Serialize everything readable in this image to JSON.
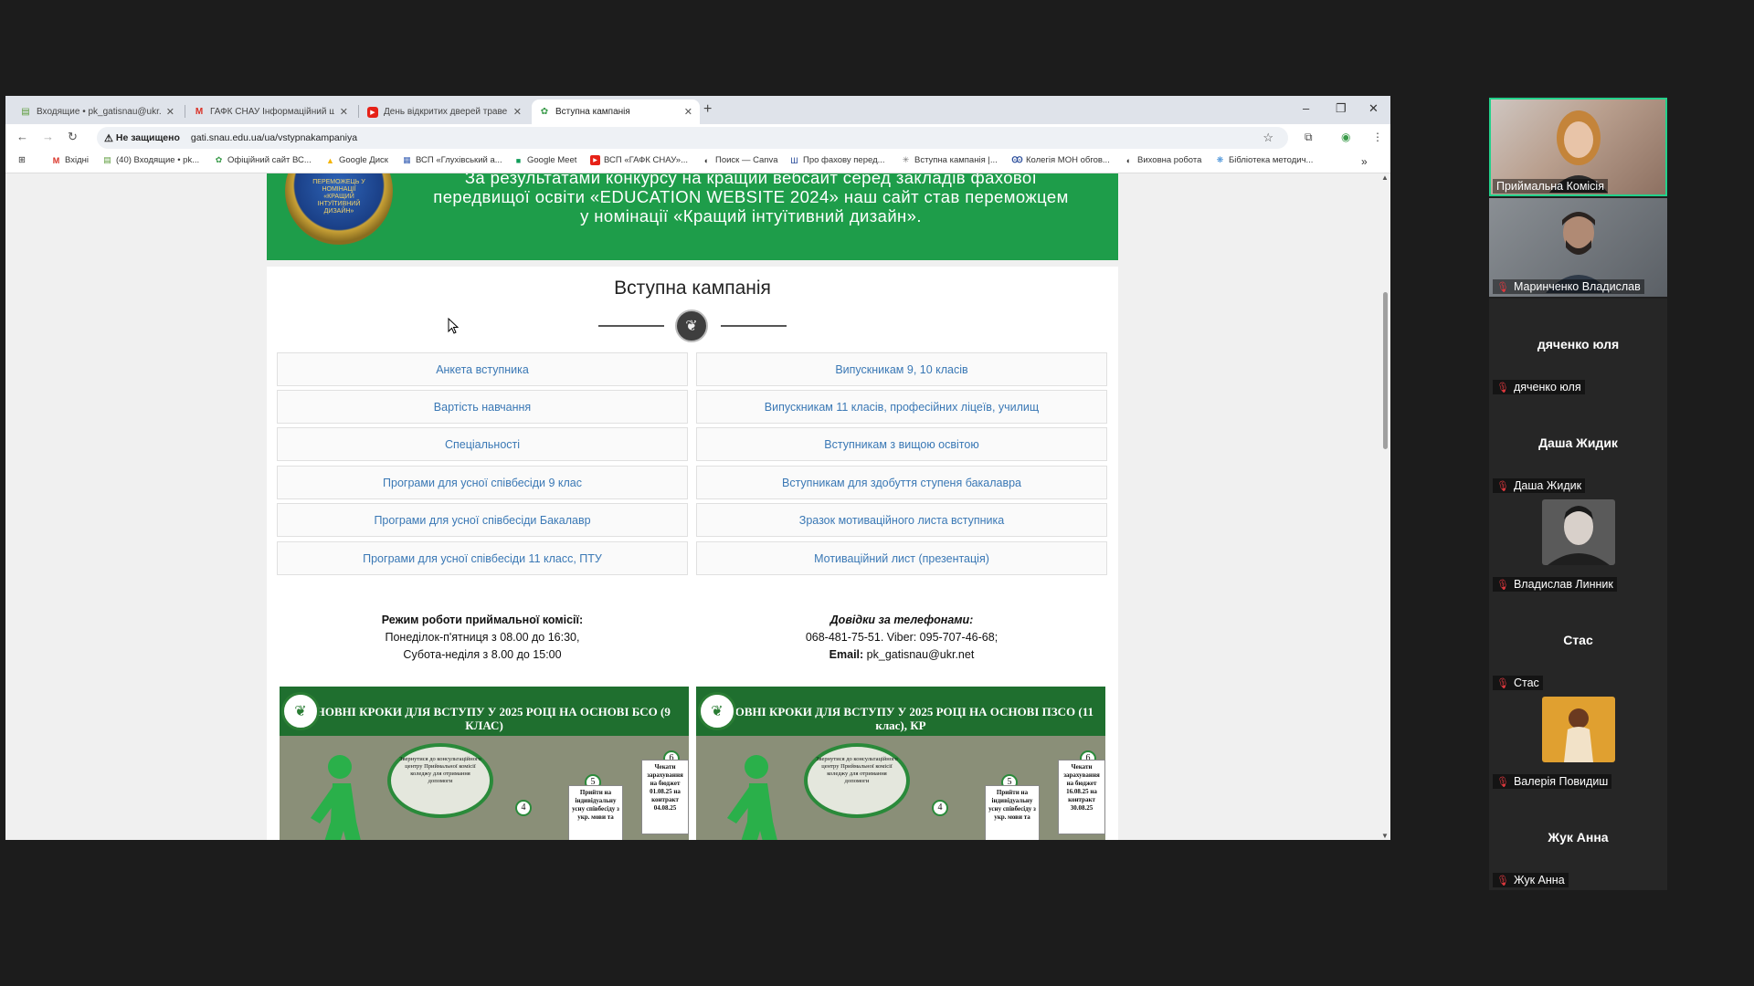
{
  "browser": {
    "tabs": [
      {
        "title": "Входящие • pk_gatisnau@ukr.net",
        "active": false
      },
      {
        "title": "ГАФК СНАУ Інформаційний ш",
        "active": false
      },
      {
        "title": "День відкритих дверей траве",
        "active": false
      },
      {
        "title": "Вступна кампанія",
        "active": true
      }
    ],
    "new_tab": "+",
    "window_controls": {
      "minimize": "–",
      "restore": "❐",
      "close": "✕"
    },
    "nav": {
      "back": "←",
      "forward": "→",
      "reload": "↻"
    },
    "security_label": "Не защищено",
    "url": "gati.snau.edu.ua/ua/vstypnakampaniya",
    "bookmarks": [
      "Вхідні",
      "(40) Входящие • pk...",
      "Офіційний сайт ВС...",
      "Google Диск",
      "ВСП «Глухівський а...",
      "Google Meet",
      "ВСП «ГАФК СНАУ»...",
      "Поиск — Canva",
      "Про фахову перед...",
      "Вступна кампанія |...",
      "Колегія МОН обгов...",
      "Виховна робота",
      "Бібліотека методич..."
    ],
    "bookmarks_more": "»"
  },
  "page": {
    "banner": {
      "medal_text": "ПЕРЕМОЖЕЦЬ У НОМІНАЦІЇ «КРАЩИЙ ІНТУЇТИВНИЙ ДИЗАЙН»",
      "text": "За результатами конкурсу на кращий вебсайт серед закладів фахової передвищої освіти «EDUCATION WEBSITE 2024» наш сайт став переможцем у номінації «Кращий інтуїтивний дизайн»."
    },
    "section_title": "Вступна кампанія",
    "links_left": [
      "Анкета вступника",
      "Вартість навчання",
      "Спеціальності",
      "Програми для усної співбесіди 9 клас",
      "Програми для усної співбесіди Бакалавр",
      "Програми для усної співбесіди 11 класс, ПТУ"
    ],
    "links_right": [
      "Випускникам 9, 10 класів",
      "Випускникам 11 класів, професійних ліцеїв, училищ",
      "Вступникам з вищою освітою",
      "Вступникам для здобуття ступеня бакалавра",
      "Зразок мотиваційного листа вступника",
      "Мотиваційний лист (презентація)"
    ],
    "hours": {
      "title": "Режим роботи приймальної комісії:",
      "line1": "Понеділок-п'ятниця з 08.00 до 16:30,",
      "line2": "Субота-неділя з 8.00 до 15:00"
    },
    "contacts": {
      "title": "Довідки за телефонами:",
      "phones": "068-481-75-51. Viber: 095-707-46-68;",
      "email_label": "Email:",
      "email": "pk_gatisnau@ukr.net"
    },
    "posters": [
      {
        "header": "ОСНОВНІ КРОКИ ДЛЯ ВСТУПУ У 2025 РОЦІ НА ОСНОВІ БСО (9 КЛАС)",
        "oval_text": "Звернутися до консультаційного центру Приймальної комісії коледжу для отримання допомоги",
        "step4": "4",
        "step5": "5",
        "step6": "6",
        "box5": "Прийти на індивідуальну усну співбесіду з укр. мови та",
        "box6": "Чекати зарахування на бюджет 01.08.25 на контракт 04.08.25"
      },
      {
        "header": "ОСНОВНІ КРОКИ ДЛЯ ВСТУПУ У 2025 РОЦІ НА ОСНОВІ ПЗСО (11 клас), КР",
        "oval_text": "Звернутися до консультаційного центру Приймальної комісії коледжу для отримання допомоги",
        "step4": "4",
        "step5": "5",
        "step6": "6",
        "box5": "Прийти на індивідуальну усну співбесіду з укр. мови та",
        "box6": "Чекати зарахування на бюджет 16.08.25 на контракт 30.08.25"
      }
    ]
  },
  "zoom": {
    "participants": [
      {
        "name": "Приймальна Комісія",
        "video": true,
        "speaking": true
      },
      {
        "name": "Маринченко Владислав",
        "video": true,
        "speaking": false
      },
      {
        "name": "дяченко юля",
        "video": false
      },
      {
        "name": "Даша Жидик",
        "video": false
      },
      {
        "name": "Владислав Линник",
        "video": false,
        "avatar": true
      },
      {
        "name": "Стас",
        "video": false
      },
      {
        "name": "Валерія Повидиш",
        "video": false,
        "avatar": true
      },
      {
        "name": "Жук Анна",
        "video": false
      }
    ]
  },
  "colors": {
    "banner_green": "#1e9d4a",
    "link_blue": "#3a78b5",
    "zoom_speaking": "#23d18b"
  }
}
